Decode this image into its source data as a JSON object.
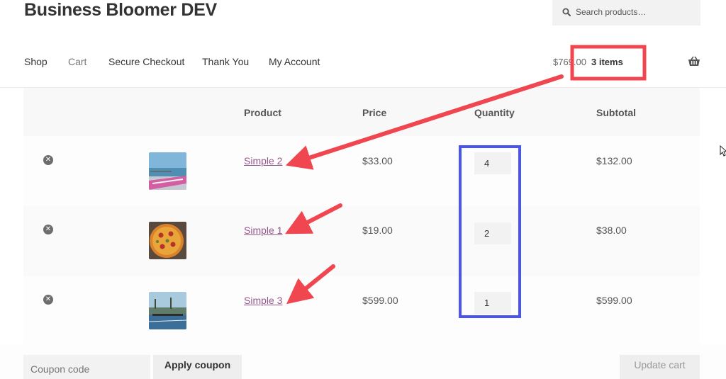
{
  "site": {
    "title": "Business Bloomer DEV"
  },
  "search": {
    "placeholder": "Search products…"
  },
  "nav": {
    "items": [
      "Shop",
      "Cart",
      "Secure Checkout",
      "Thank You",
      "My Account"
    ]
  },
  "header_cart": {
    "total": "$769.00",
    "count": "3 items"
  },
  "table": {
    "headers": {
      "product": "Product",
      "price": "Price",
      "quantity": "Quantity",
      "subtotal": "Subtotal"
    },
    "rows": [
      {
        "product": "Simple 2",
        "price": "$33.00",
        "quantity": "4",
        "subtotal": "$132.00",
        "thumb": "sea-pier-photo"
      },
      {
        "product": "Simple 1",
        "price": "$19.00",
        "quantity": "2",
        "subtotal": "$38.00",
        "thumb": "pizza-photo"
      },
      {
        "product": "Simple 3",
        "price": "$599.00",
        "quantity": "1",
        "subtotal": "$599.00",
        "thumb": "tennis-court-photo"
      }
    ]
  },
  "actions": {
    "coupon_placeholder": "Coupon code",
    "apply_label": "Apply coupon",
    "update_label": "Update cart"
  },
  "colors": {
    "link": "#96588a",
    "annotation_red": "#f04650",
    "annotation_blue": "#4a55f0"
  },
  "icons": [
    "search-icon",
    "basket-icon",
    "remove-icon",
    "cursor-icon"
  ]
}
